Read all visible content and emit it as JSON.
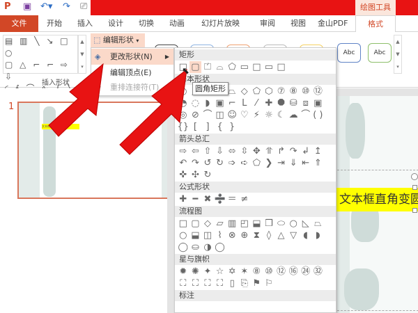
{
  "window": {
    "app_icon": "P",
    "contextual_tab_group": "绘图工具"
  },
  "tabs": [
    "文件",
    "开始",
    "插入",
    "设计",
    "切换",
    "动画",
    "幻灯片放映",
    "审阅",
    "视图",
    "金山PDF",
    "格式"
  ],
  "ribbon": {
    "insert_shapes_gallery": [
      "▤ ▥ ╲ ↘ □ ○",
      "▢ △ ⌐ ⌐ ⇨ ⇩",
      "◜ ∮ ⌒ ∿ { ╲"
    ],
    "insert_shapes_label": "插入形状",
    "edit_shape_button": "编辑形状",
    "style_labels": [
      "Abc",
      "Abc"
    ],
    "style_colors": [
      "#444444",
      "#8fb4e3",
      "#f0a070",
      "#bbbbbb",
      "#f5d060",
      "#5f83c6",
      "#8dbf6a"
    ]
  },
  "edit_menu": {
    "items": [
      {
        "label": "更改形状(N)",
        "enabled": true,
        "submenu": true
      },
      {
        "label": "编辑顶点(E)",
        "enabled": true
      },
      {
        "label": "重排连接符(T)",
        "enabled": false
      }
    ]
  },
  "shapes_menu": {
    "sections": [
      {
        "title": "矩形",
        "rows": [
          [
            "□",
            "▢",
            "⏍",
            "⌓",
            "⬠",
            "▭",
            "□",
            "▭",
            "□"
          ]
        ]
      },
      {
        "title": "基本形状",
        "rows": [
          [
            "○",
            "△",
            "⊿",
            "▱",
            "⏢",
            "◇",
            "⬠",
            "⬡",
            "⑦",
            "⑧",
            "⑩",
            "⑫"
          ],
          [
            "◔",
            "◌",
            "◗",
            "▣",
            "⌐",
            "L",
            "⁄",
            "✚",
            "⯃",
            "⛁",
            "⧈",
            "▣"
          ],
          [
            "◎",
            "⊘",
            "⌒",
            "◫",
            "☺",
            "♡",
            "⚡",
            "☼",
            "☾",
            "☁",
            "⌒",
            "( )"
          ],
          [
            "{}",
            "[",
            "]",
            "{",
            "}"
          ]
        ]
      },
      {
        "title": "箭头总汇",
        "rows": [
          [
            "⇨",
            "⇦",
            "⇧",
            "⇩",
            "⬄",
            "⇳",
            "✥",
            "⥣",
            "↱",
            "↷",
            "↲",
            "↥"
          ],
          [
            "↶",
            "↷",
            "↺",
            "↻",
            "➩",
            "➪",
            "⬠",
            "❯",
            "⇥",
            "⇓",
            "⇤",
            "⇑"
          ],
          [
            "✜",
            "✣",
            "↻"
          ]
        ]
      },
      {
        "title": "公式形状",
        "rows": [
          [
            "✚",
            "━",
            "✖",
            "➗",
            "＝",
            "≠"
          ]
        ]
      },
      {
        "title": "流程图",
        "rows": [
          [
            "□",
            "▢",
            "◇",
            "▱",
            "▥",
            "◰",
            "⬓",
            "❒",
            "⬭",
            "○",
            "◺",
            "⏢"
          ],
          [
            "○",
            "⬓",
            "◫",
            "⌇",
            "⊗",
            "⊕",
            "⧗",
            "◊",
            "△",
            "▽",
            "◖",
            "◗"
          ],
          [
            "◯",
            "⛀",
            "◑",
            "◯"
          ]
        ]
      },
      {
        "title": "星与旗帜",
        "rows": [
          [
            "✹",
            "✺",
            "✦",
            "☆",
            "✡",
            "✶",
            "⑧",
            "⑩",
            "⑫",
            "⑯",
            "㉔",
            "㉜"
          ],
          [
            "⛶",
            "⛶",
            "⛶",
            "⛶",
            "▯",
            "⎘",
            "⚑",
            "⚐"
          ]
        ]
      },
      {
        "title": "标注",
        "rows": []
      }
    ],
    "tooltip": "圆角矩形"
  },
  "thumbnail": {
    "number": "1",
    "text": "文本框直角变圆角"
  },
  "slide": {
    "textbox": "文本框直角变圆角"
  }
}
